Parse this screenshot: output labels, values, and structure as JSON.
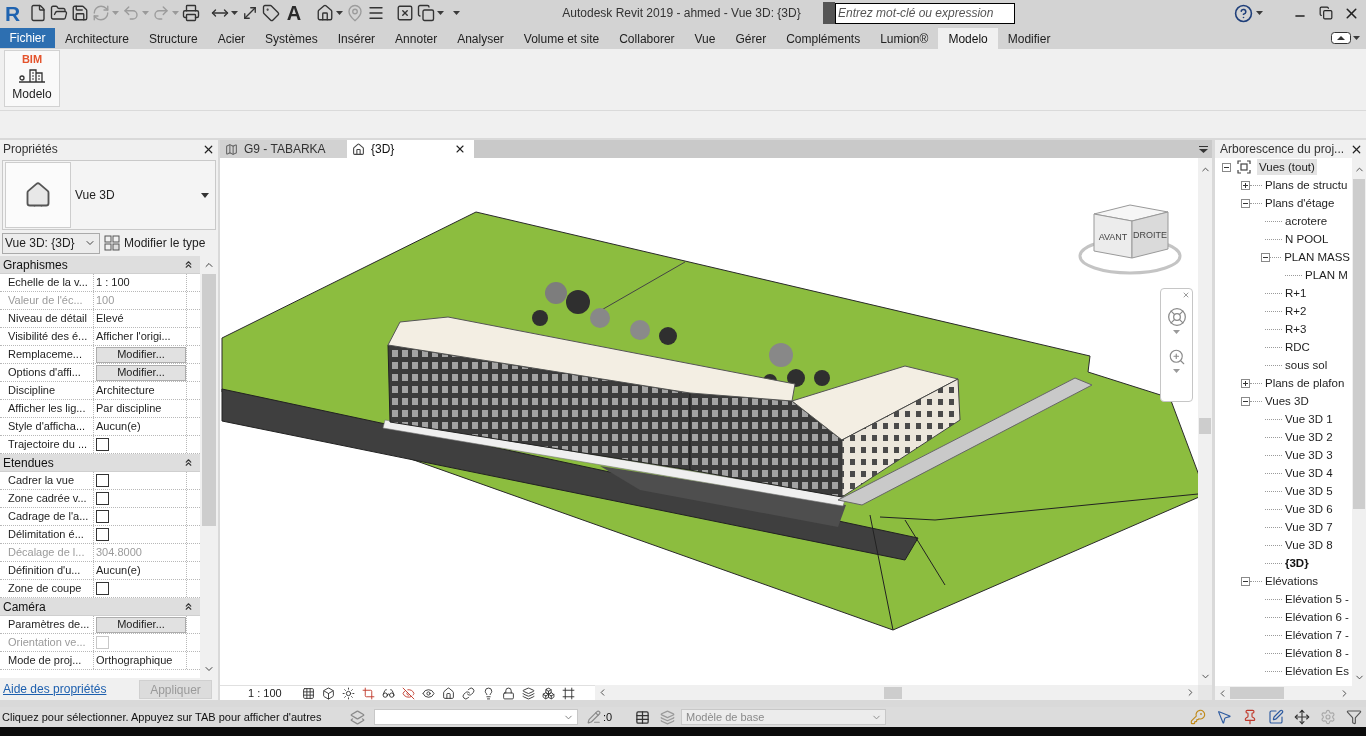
{
  "title_bar": {
    "logo": "R",
    "text_tool": "A",
    "app_title": "Autodesk Revit 2019 - ahmed - Vue 3D: {3D}",
    "search": {
      "placeholder": "Entrez mot-clé ou expression"
    }
  },
  "menu_tabs": [
    {
      "label": "Fichier",
      "kind": "file",
      "selected": false
    },
    {
      "label": "Architecture",
      "kind": "tab",
      "selected": false
    },
    {
      "label": "Structure",
      "kind": "tab",
      "selected": false
    },
    {
      "label": "Acier",
      "kind": "tab",
      "selected": false
    },
    {
      "label": "Systèmes",
      "kind": "tab",
      "selected": false
    },
    {
      "label": "Insérer",
      "kind": "tab",
      "selected": false
    },
    {
      "label": "Annoter",
      "kind": "tab",
      "selected": false
    },
    {
      "label": "Analyser",
      "kind": "tab",
      "selected": false
    },
    {
      "label": "Volume et site",
      "kind": "tab",
      "selected": false
    },
    {
      "label": "Collaborer",
      "kind": "tab",
      "selected": false
    },
    {
      "label": "Vue",
      "kind": "tab",
      "selected": false
    },
    {
      "label": "Gérer",
      "kind": "tab",
      "selected": false
    },
    {
      "label": "Compléments",
      "kind": "tab",
      "selected": false
    },
    {
      "label": "Lumion®",
      "kind": "tab",
      "selected": false
    },
    {
      "label": "Modelo",
      "kind": "tab",
      "selected": true
    },
    {
      "label": "Modifier",
      "kind": "tab",
      "selected": false
    }
  ],
  "ribbon": {
    "tools": [
      {
        "badge": "BIM",
        "label": "Modelo"
      }
    ]
  },
  "properties": {
    "title": "Propriétés",
    "type_name": "Vue 3D",
    "view_selector": "Vue 3D: {3D}",
    "edit_type": "Modifier le type",
    "rows": [
      {
        "kind": "group",
        "label": "Graphismes",
        "expanded": true
      },
      {
        "kind": "text",
        "label": "Echelle de la v...",
        "value": "1 : 100",
        "disabled": false
      },
      {
        "kind": "text",
        "label": "Valeur de l'éc...",
        "value": "100",
        "disabled": true
      },
      {
        "kind": "text",
        "label": "Niveau de détail",
        "value": "Elevé",
        "disabled": false
      },
      {
        "kind": "text",
        "label": "Visibilité des é...",
        "value": "Afficher l'origi...",
        "disabled": false
      },
      {
        "kind": "button",
        "label": "Remplaceme...",
        "value": "Modifier...",
        "disabled": false
      },
      {
        "kind": "button",
        "label": "Options d'affi...",
        "value": "Modifier...",
        "disabled": false
      },
      {
        "kind": "text",
        "label": "Discipline",
        "value": "Architecture",
        "disabled": false
      },
      {
        "kind": "text",
        "label": "Afficher les lig...",
        "value": "Par discipline",
        "disabled": false
      },
      {
        "kind": "text",
        "label": "Style d'afficha...",
        "value": "Aucun(e)",
        "disabled": false
      },
      {
        "kind": "checkbox",
        "label": "Trajectoire du ...",
        "checked": false,
        "disabled": false
      },
      {
        "kind": "group",
        "label": "Etendues",
        "expanded": true
      },
      {
        "kind": "checkbox",
        "label": "Cadrer la vue",
        "checked": false,
        "disabled": false
      },
      {
        "kind": "checkbox",
        "label": "Zone cadrée v...",
        "checked": false,
        "disabled": false
      },
      {
        "kind": "checkbox",
        "label": "Cadrage de l'a...",
        "checked": false,
        "disabled": false
      },
      {
        "kind": "checkbox",
        "label": "Délimitation é...",
        "checked": false,
        "disabled": false
      },
      {
        "kind": "text",
        "label": "Décalage de l...",
        "value": "304.8000",
        "disabled": true
      },
      {
        "kind": "text",
        "label": "Définition d'u...",
        "value": "Aucun(e)",
        "disabled": false
      },
      {
        "kind": "checkbox",
        "label": "Zone de coupe",
        "checked": false,
        "disabled": false
      },
      {
        "kind": "group",
        "label": "Caméra",
        "expanded": true
      },
      {
        "kind": "button",
        "label": "Paramètres de...",
        "value": "Modifier...",
        "disabled": false
      },
      {
        "kind": "checkbox",
        "label": "Orientation ve...",
        "checked": false,
        "disabled": true
      },
      {
        "kind": "text",
        "label": "Mode de proj...",
        "value": "Orthographique",
        "disabled": false
      }
    ],
    "help_link": "Aide des propriétés",
    "apply_button": {
      "label": "Appliquer",
      "disabled": true
    }
  },
  "view": {
    "tabs": [
      {
        "label": "G9 - TABARKA",
        "kind": "plan",
        "selected": false
      },
      {
        "label": "{3D}",
        "kind": "model",
        "selected": true
      }
    ],
    "view_cube": {
      "front_label": "AVANT",
      "right_label": "DROITE"
    },
    "scale": "1 : 100"
  },
  "project_browser": {
    "title": "Arborescence du proj...",
    "tree": [
      {
        "label": "Vues (tout)",
        "expanded": true,
        "selected": true,
        "current": false,
        "children": [
          {
            "label": "Plans de structu",
            "expanded": false,
            "selected": false,
            "current": false
          },
          {
            "label": "Plans d'étage",
            "expanded": true,
            "selected": false,
            "current": false,
            "children": [
              {
                "label": "acrotere",
                "selected": false,
                "current": false
              },
              {
                "label": "N POOL",
                "selected": false,
                "current": false
              },
              {
                "label": "PLAN MASS",
                "expanded": true,
                "selected": false,
                "current": false,
                "children": [
                  {
                    "label": "PLAN M",
                    "selected": false,
                    "current": false
                  }
                ]
              },
              {
                "label": "R+1",
                "selected": false,
                "current": false
              },
              {
                "label": "R+2",
                "selected": false,
                "current": false
              },
              {
                "label": "R+3",
                "selected": false,
                "current": false
              },
              {
                "label": "RDC",
                "selected": false,
                "current": false
              },
              {
                "label": "sous sol",
                "selected": false,
                "current": false
              }
            ]
          },
          {
            "label": "Plans de plafon",
            "expanded": false,
            "selected": false,
            "current": false
          },
          {
            "label": "Vues 3D",
            "expanded": true,
            "selected": false,
            "current": false,
            "children": [
              {
                "label": "Vue 3D 1",
                "selected": false,
                "current": false
              },
              {
                "label": "Vue 3D 2",
                "selected": false,
                "current": false
              },
              {
                "label": "Vue 3D 3",
                "selected": false,
                "current": false
              },
              {
                "label": "Vue 3D 4",
                "selected": false,
                "current": false
              },
              {
                "label": "Vue 3D 5",
                "selected": false,
                "current": false
              },
              {
                "label": "Vue 3D 6",
                "selected": false,
                "current": false
              },
              {
                "label": "Vue 3D 7",
                "selected": false,
                "current": false
              },
              {
                "label": "Vue 3D 8",
                "selected": false,
                "current": false
              },
              {
                "label": "{3D}",
                "selected": false,
                "current": true
              }
            ]
          },
          {
            "label": "Elévations",
            "expanded": true,
            "selected": false,
            "current": false,
            "children": [
              {
                "label": "Elévation 5 -",
                "selected": false,
                "current": false
              },
              {
                "label": "Elévation 6 -",
                "selected": false,
                "current": false
              },
              {
                "label": "Elévation 7 -",
                "selected": false,
                "current": false
              },
              {
                "label": "Elévation 8 -",
                "selected": false,
                "current": false
              },
              {
                "label": "Elévation Es",
                "selected": false,
                "current": false
              }
            ]
          }
        ]
      }
    ]
  },
  "status_bar": {
    "message": "Cliquez pour sélectionner. Appuyez sur TAB pour afficher d'autres",
    "selection_count": ":0",
    "workset": {
      "value": "Modèle de base",
      "disabled": true
    }
  }
}
